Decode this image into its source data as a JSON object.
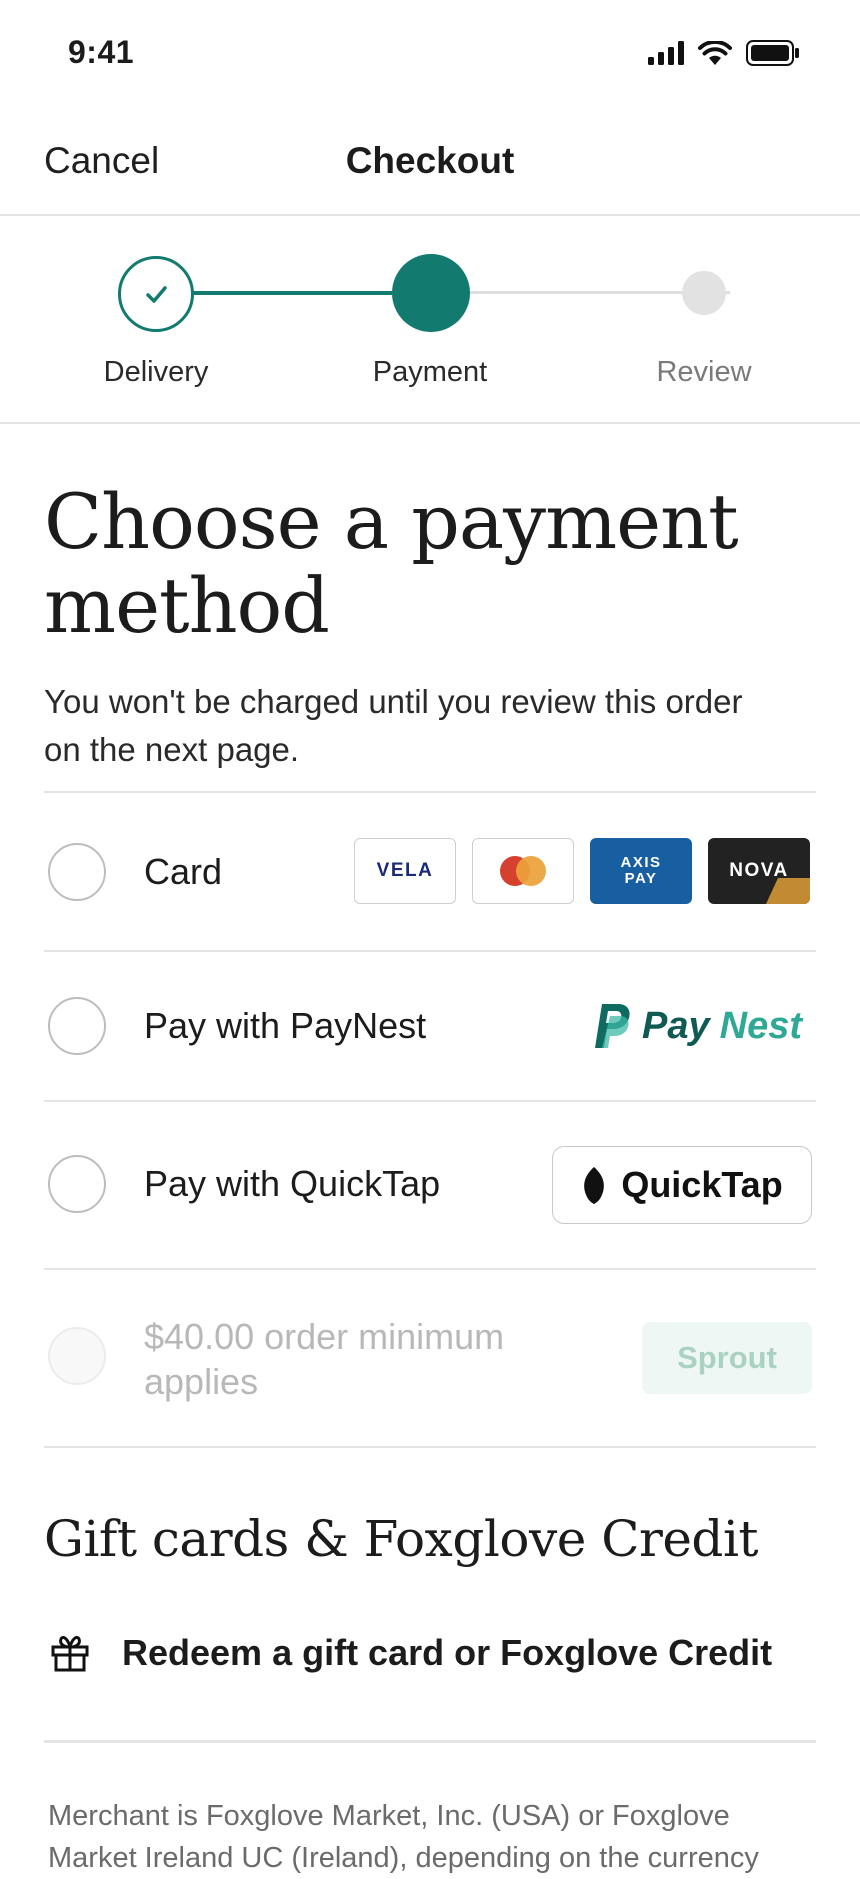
{
  "status_bar": {
    "time": "9:41"
  },
  "nav": {
    "cancel_label": "Cancel",
    "title": "Checkout"
  },
  "stepper": {
    "steps": [
      {
        "label": "Delivery",
        "state": "complete"
      },
      {
        "label": "Payment",
        "state": "current"
      },
      {
        "label": "Review",
        "state": "upcoming"
      }
    ],
    "active_color": "#127a6e"
  },
  "page": {
    "heading_line1": "Choose a payment",
    "heading_line2": "method",
    "subtext": "You won't be charged until you review this order on the next page."
  },
  "payment_options": {
    "card": {
      "label": "Card",
      "logos": [
        "VELA",
        "mastercard-icon",
        "AXIS PAY",
        "NOVA"
      ],
      "axis_line1": "AXIS",
      "axis_line2": "PAY"
    },
    "paynest": {
      "label": "Pay with PayNest",
      "logo_pay": "Pay",
      "logo_nest": "Nest"
    },
    "quicktap": {
      "label": "Pay with QuickTap",
      "button_label": "QuickTap"
    },
    "sprout": {
      "label": "$40.00 order minimum applies",
      "badge": "Sprout",
      "disabled": true
    }
  },
  "gift": {
    "section_title": "Gift cards & Foxglove Credit",
    "redeem_label": "Redeem a gift card or Foxglove Credit"
  },
  "legal": {
    "text": "Merchant is Foxglove Market, Inc. (USA) or Foxglove Market Ireland UC (Ireland), depending on the currency"
  }
}
